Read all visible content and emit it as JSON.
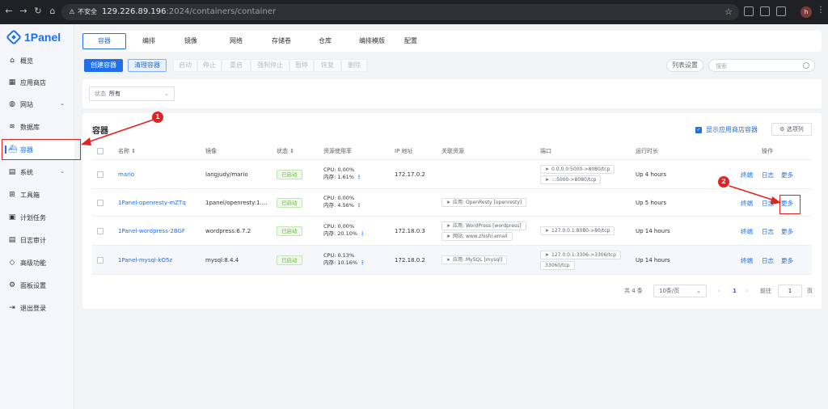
{
  "browser": {
    "security_label": "不安全",
    "url_host": "129.226.89.196",
    "url_path": ":2024/containers/container",
    "profile_initial": "h"
  },
  "sidebar": {
    "logo": "1Panel",
    "items": [
      {
        "label": "概览",
        "icon": "home-icon"
      },
      {
        "label": "应用商店",
        "icon": "grid-icon"
      },
      {
        "label": "网站",
        "icon": "globe-icon"
      },
      {
        "label": "数据库",
        "icon": "database-icon"
      },
      {
        "label": "容器",
        "icon": "docker-icon"
      },
      {
        "label": "系统",
        "icon": "system-icon"
      },
      {
        "label": "工具箱",
        "icon": "toolbox-icon"
      },
      {
        "label": "计划任务",
        "icon": "calendar-icon"
      },
      {
        "label": "日志审计",
        "icon": "log-icon"
      },
      {
        "label": "高级功能",
        "icon": "diamond-icon"
      },
      {
        "label": "面板设置",
        "icon": "gear-icon"
      },
      {
        "label": "退出登录",
        "icon": "logout-icon"
      }
    ]
  },
  "tabs": [
    "容器",
    "编排",
    "镜像",
    "网络",
    "存储卷",
    "仓库",
    "编排模版",
    "配置"
  ],
  "toolbar": {
    "create": "创建容器",
    "clean": "清理容器",
    "actions": [
      "启动",
      "停止",
      "重启",
      "强制停止",
      "暂停",
      "恢复",
      "删除"
    ],
    "list_settings": "列表设置",
    "search_placeholder": "搜索"
  },
  "filter": {
    "label": "状态",
    "value": "所有"
  },
  "table": {
    "title": "容器",
    "show_app_store": "显示应用商店容器",
    "columns_button": "选项列",
    "headers": {
      "name": "名称",
      "image": "镜像",
      "status": "状态",
      "resource": "资源使用率",
      "ip": "IP 地址",
      "related": "关联资源",
      "ports": "端口",
      "uptime": "运行时长",
      "actions": "操作"
    },
    "rows": [
      {
        "name": "mario",
        "image": "langjudy/mario",
        "status": "已启动",
        "cpu": "CPU: 0.00%",
        "mem": "内存: 1.61%",
        "ip": "172.17.0.2",
        "related": [],
        "ports": [
          "0.0.0.0:5000->8080/tcp",
          ":::5000->8080/tcp"
        ],
        "uptime": "Up 4 hours"
      },
      {
        "name": "1Panel-openresty-mZTq",
        "image": "1panel/openresty:1....",
        "status": "已启动",
        "cpu": "CPU: 0.00%",
        "mem": "内存: 4.56%",
        "ip": "",
        "related": [
          "应用: OpenResty [openresty]"
        ],
        "ports": [],
        "uptime": "Up 5 hours"
      },
      {
        "name": "1Panel-wordpress-2BGF",
        "image": "wordpress:6.7.2",
        "status": "已启动",
        "cpu": "CPU: 0.00%",
        "mem": "内存: 20.10%",
        "ip": "172.18.0.3",
        "related": [
          "应用: WordPress [wordpress]",
          "网站: www.zhishi.email"
        ],
        "ports": [
          "127.0.0.1:8080->80/tcp"
        ],
        "uptime": "Up 14 hours"
      },
      {
        "name": "1Panel-mysql-kO5z",
        "image": "mysql:8.4.4",
        "status": "已启动",
        "cpu": "CPU: 0.13%",
        "mem": "内存: 10.16%",
        "ip": "172.18.0.2",
        "related": [
          "应用: MySQL [mysql]"
        ],
        "ports": [
          "127.0.0.1:3306->3306/tcp",
          "33060/tcp"
        ],
        "uptime": "Up 14 hours"
      }
    ],
    "ops": {
      "terminal": "终端",
      "log": "日志",
      "more": "更多"
    }
  },
  "pager": {
    "total": "共 4 条",
    "page_size": "10条/页",
    "current_page": "1",
    "goto_label": "前往",
    "goto_value": "1",
    "page_unit": "页"
  },
  "markers": [
    "1",
    "2"
  ]
}
